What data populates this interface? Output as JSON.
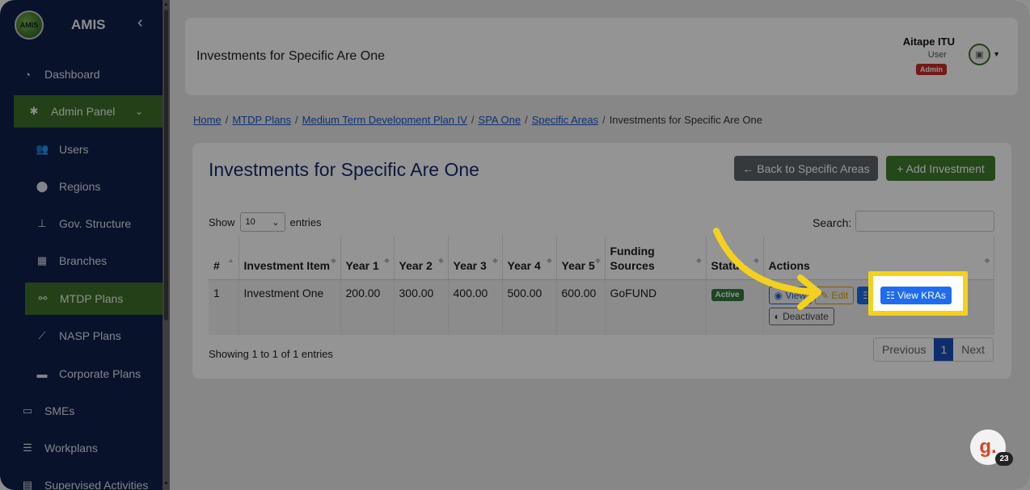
{
  "app": {
    "logo_text": "AMIS",
    "name": "AMIS",
    "toggle": "‹"
  },
  "sidebar": {
    "items": [
      {
        "label": "Dashboard",
        "icon": "dashboard-icon"
      },
      {
        "label": "Admin Panel",
        "icon": "gear-icon"
      },
      {
        "label": "Users",
        "icon": "users-icon"
      },
      {
        "label": "Regions",
        "icon": "map-pin-icon"
      },
      {
        "label": "Gov. Structure",
        "icon": "sitemap-icon"
      },
      {
        "label": "Branches",
        "icon": "building-icon"
      },
      {
        "label": "MTDP Plans",
        "icon": "network-icon"
      },
      {
        "label": "NASP Plans",
        "icon": "chart-line-icon"
      },
      {
        "label": "Corporate Plans",
        "icon": "briefcase-icon"
      },
      {
        "label": "SMEs",
        "icon": "store-icon"
      },
      {
        "label": "Workplans",
        "icon": "list-icon"
      },
      {
        "label": "Supervised Activities",
        "icon": "clipboard-icon"
      }
    ]
  },
  "header": {
    "title": "Investments for Specific Are One",
    "user_name": "Aitape ITU",
    "user_role": "User",
    "user_badge": "Admin"
  },
  "breadcrumb": {
    "links": [
      "Home",
      "MTDP Plans",
      "Medium Term Development Plan IV",
      "SPA One",
      "Specific Areas"
    ],
    "current": "Investments for Specific Are One",
    "separator": "/"
  },
  "card": {
    "title": "Investments for Specific Are One",
    "back_button": "← Back to Specific Areas",
    "add_button": "+ Add Investment",
    "show_label": "Show",
    "entries_label": "entries",
    "page_length": "10",
    "search_label": "Search:",
    "search_value": ""
  },
  "table": {
    "columns": [
      "#",
      "Investment Item",
      "Year 1",
      "Year 2",
      "Year 3",
      "Year 4",
      "Year 5",
      "Funding Sources",
      "Status",
      "Actions"
    ],
    "rows": [
      {
        "num": "1",
        "item": "Investment One",
        "y1": "200.00",
        "y2": "300.00",
        "y3": "400.00",
        "y4": "500.00",
        "y5": "600.00",
        "funding": "GoFUND",
        "status": "Active",
        "actions": {
          "view": "View",
          "edit": "Edit",
          "kras": "View KRAs",
          "deactivate": "Deactivate"
        }
      }
    ]
  },
  "footer": {
    "showing": "Showing 1 to 1 of 1 entries",
    "previous": "Previous",
    "page": "1",
    "next": "Next"
  },
  "widget": {
    "logo": "g.",
    "count": "23"
  },
  "colors": {
    "sidebar": "#0f1f4a",
    "accent_green": "#3f7c2d",
    "primary_blue": "#1e6cf2",
    "highlight": "#f4d11e"
  }
}
